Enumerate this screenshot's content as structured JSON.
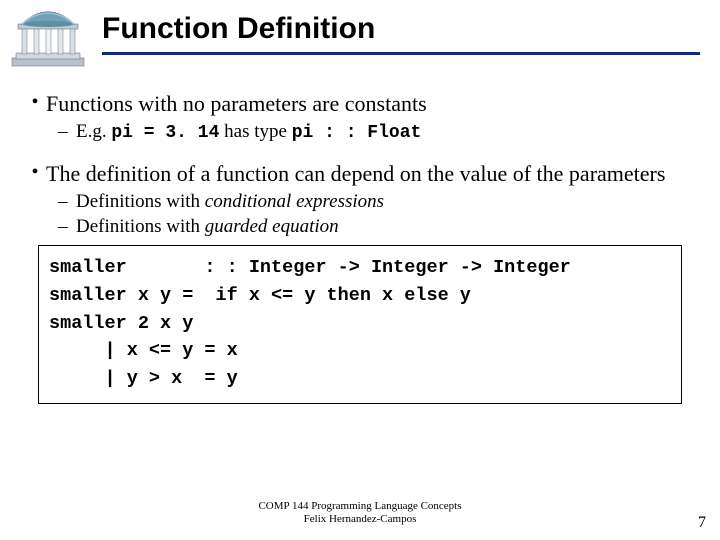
{
  "header": {
    "title": "Function Definition",
    "logo_name": "unc-old-well-logo"
  },
  "bullets": {
    "b1": {
      "text": "Functions with no parameters are constants",
      "sub1_pre": "E.g. ",
      "sub1_code1": "pi = 3. 14",
      "sub1_mid": " has type ",
      "sub1_code2": "pi : : Float"
    },
    "b2": {
      "text": "The definition of a function can depend on the value of the parameters",
      "sub1_pre": "Definitions with ",
      "sub1_em": "conditional expressions",
      "sub2_pre": "Definitions with ",
      "sub2_em": "guarded equation"
    }
  },
  "code": {
    "l1": "smaller       : : Integer -> Integer -> Integer",
    "l2": "smaller x y =  if x <= y then x else y",
    "l3": "smaller 2 x y",
    "l4": "     | x <= y = x",
    "l5": "     | y > x  = y"
  },
  "footer": {
    "line1": "COMP 144 Programming Language Concepts",
    "line2": "Felix Hernandez-Campos"
  },
  "page_number": "7"
}
